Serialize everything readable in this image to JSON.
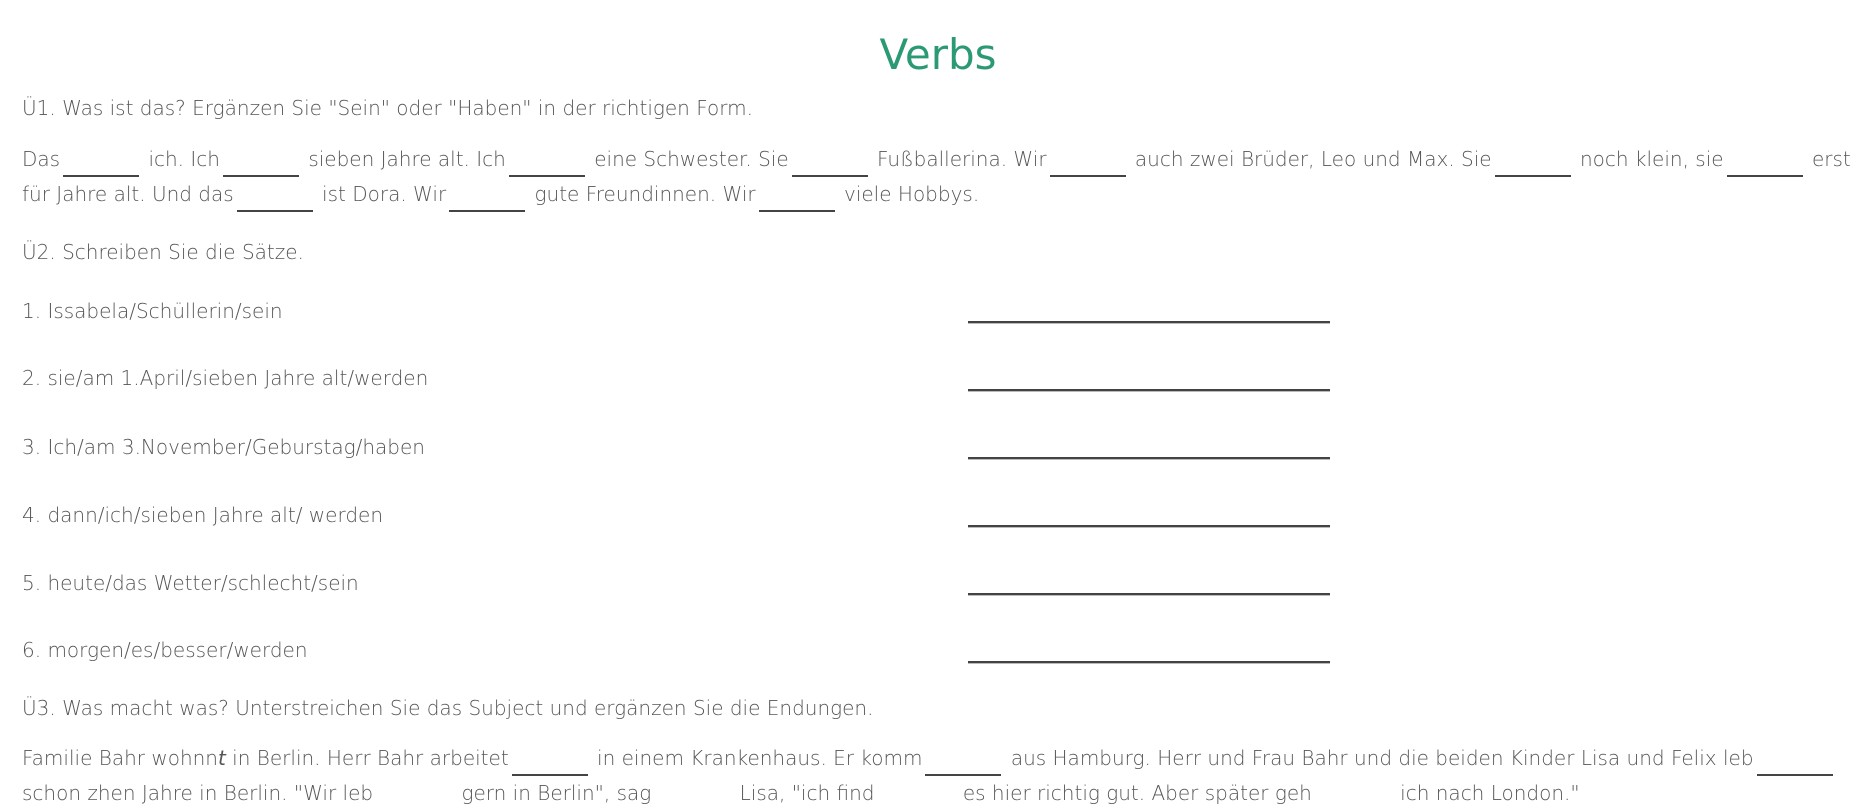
{
  "title": "Verbs",
  "section1": {
    "heading": "Ü1. Was ist das? Ergänzen Sie \"Sein\" oder \"Haben\" in der richtigen Form.",
    "text": [
      "Das",
      "ich. Ich",
      "sieben Jahre alt. Ich",
      "eine Schwester. Sie",
      "Fußballerina. Wir",
      "auch zwei Brüder, Leo und Max. Sie",
      "noch klein, sie",
      "erst für Jahre alt. Und das",
      "ist Dora. Wir",
      "gute Freundinnen. Wir",
      "viele Hobbys."
    ]
  },
  "section2": {
    "heading": "Ü2. Schreiben Sie die Sätze.",
    "items": [
      "1. Issabela/Schüllerin/sein",
      "2. sie/am 1.April/sieben Jahre alt/werden",
      "3. Ich/am 3.November/Geburstag/haben",
      "4. dann/ich/sieben Jahre alt/ werden",
      "5. heute/das Wetter/schlecht/sein",
      "6. morgen/es/besser/werden"
    ]
  },
  "section3": {
    "heading": "Ü3. Was macht was? Unterstreichen Sie das Subject und ergänzen Sie die Endungen.",
    "t0": "Familie Bahr wohnn",
    "t0_italic": "t",
    "t1": " in Berlin. Herr Bahr arbeitet",
    "t2": "in einem Krankenhaus. Er komm",
    "t3": "aus Hamburg. Herr und Frau Bahr und die beiden Kinder Lisa und Felix leb",
    "t4": "schon zhen Jahre in Berlin. \"Wir leb",
    "t5": "gern in Berlin\", sag",
    "t6": "Lisa, \"ich find",
    "t7": "es hier richtig gut. Aber später geh",
    "t8": "ich nach London.\""
  }
}
